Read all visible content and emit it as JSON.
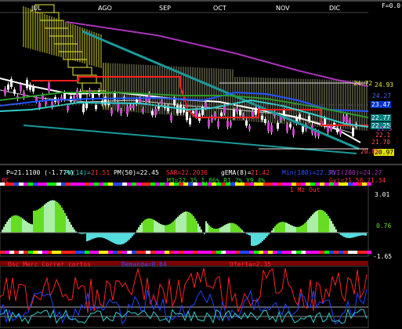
{
  "header": {
    "months": [
      "JUL",
      "AGO",
      "SEP",
      "OCT",
      "NOV",
      "DIC"
    ],
    "corner_label": "F=0.0"
  },
  "price_panel": {
    "right_axis": {
      "top": "24.72",
      "v1": "24.93",
      "v2": "24.27",
      "v3": "23.47",
      "v4": "22.77",
      "v5": "22.25",
      "v6": "22.1",
      "v7": "21.70",
      "v8": "21.5",
      "v9": "20.97",
      "v10": "20.85"
    },
    "tag_colors": {
      "v3": "#0033cc",
      "v4": "#008080",
      "v5": "#008080",
      "v9": "#e0e000"
    }
  },
  "indicator_line1": {
    "price": "P=21.1100 (-1.77%)",
    "pm14": "PM(14)=",
    "pm14_val": "21.51",
    "pm50": "PM(50)=22.45",
    "sar": "SAR=22.2036",
    "gema": "gEMA(8)=",
    "gema_val": "21.42",
    "min_max": "Min(180)=22.30",
    "pvi": "PVI(200)=24.27"
  },
  "indicator_line2": {
    "osc": "OC",
    "m": "M3=22.35 1.86% R1.2% Y9.4%",
    "gvi": "Gvi=21.58.21.34"
  },
  "oscillator_panel": {
    "title": "1 Mz Out",
    "axis_top": "3.01",
    "axis_mid": "0.76",
    "axis_bottom": "-1.65"
  },
  "bottom_panel": {
    "title_left": "Osc Merc Correr cortos",
    "title_mid": "Demanda=0.64",
    "title_right": "Oferta=2.35"
  },
  "colors": {
    "background": "#000000",
    "grid_white": "#ffffff",
    "red_line": "#ff2020",
    "green_hist": "#66dd22",
    "cyan_hist": "#55dddd",
    "blue_line": "#2244ff",
    "yellow_cloud": "#e8e840",
    "teal_line": "#1a9a9a",
    "purple_line": "#aa33bb"
  }
}
